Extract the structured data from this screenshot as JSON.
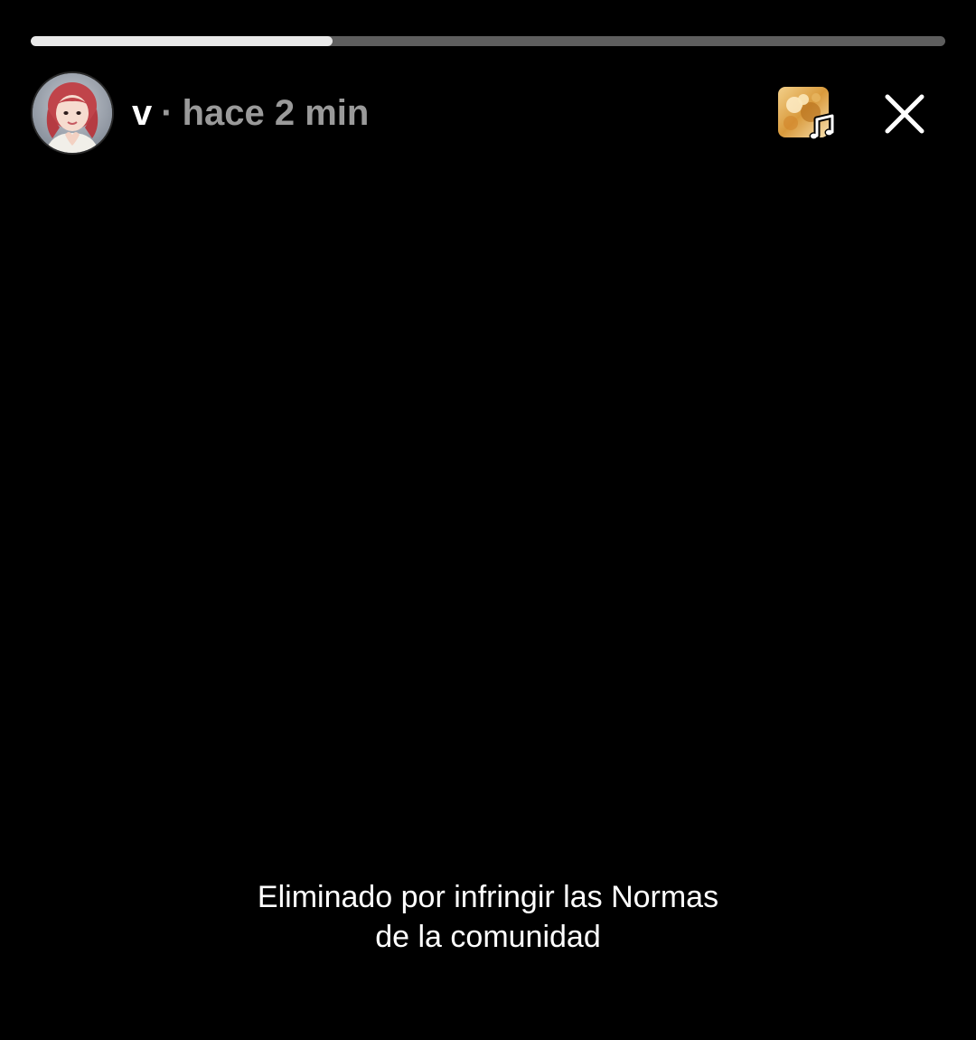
{
  "story": {
    "progress_fraction": 0.33,
    "username": "v",
    "separator": "·",
    "timestamp": "hace 2 min",
    "message_line_1": "Eliminado por infringir las Normas",
    "message_line_2": "de la comunidad"
  },
  "icons": {
    "avatar": "profile-photo",
    "music": "music-note-icon",
    "close": "close-icon"
  },
  "colors": {
    "background": "#000000",
    "progress_track": "#5e5e5e",
    "progress_fill": "#e9e9e9",
    "muted_text": "#9a9a9a"
  }
}
